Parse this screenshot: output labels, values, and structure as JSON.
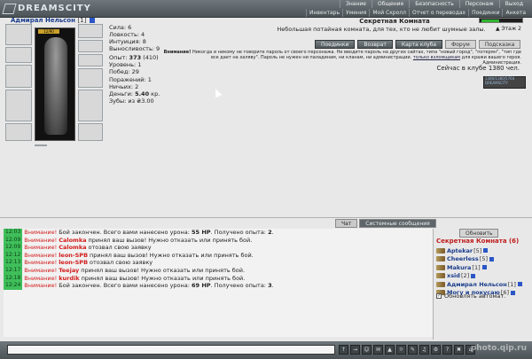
{
  "app": {
    "logo": "DREAMSCITY"
  },
  "top_menu": [
    "Знание",
    "Общение",
    "Безопасность",
    "Персонаж",
    "Выход"
  ],
  "sub_menu": [
    "Инвентарь",
    "Умения",
    "Мой Скролл",
    "Отчет о переводах",
    "Поединки",
    "Анкета"
  ],
  "character": {
    "name": "Адмирал Нельсон",
    "level": "[1]",
    "hp_label": "12/90",
    "stats": [
      "Сила: 6",
      "Ловкость: 4",
      "Интуиция: 8",
      "Выносливость: 9"
    ],
    "progress": [
      {
        "label": "Опыт: ",
        "value": "373",
        "extra": " (410)"
      },
      {
        "label": "Уровень: ",
        "value": "1",
        "extra": ""
      },
      {
        "label": "Побед: ",
        "value": "29",
        "extra": ""
      },
      {
        "label": "Поражений: ",
        "value": "1",
        "extra": ""
      },
      {
        "label": "Ничьих: ",
        "value": "2",
        "extra": ""
      },
      {
        "label": "Деньги: ",
        "value": "5.40",
        "extra": " кр."
      },
      {
        "label": "Зубы: ",
        "value": "из",
        "extra": " ₴3.00"
      }
    ]
  },
  "room": {
    "title": "Секретная Комната",
    "subtitle": "Небольшая потайная комната, для тех, кто не любит шумные залы.",
    "floor": "Этаж 2",
    "actions": [
      "Поединки",
      "Возврат",
      "Карта клуба",
      "Форум",
      "Подсказка"
    ],
    "notice_label": "Внимание!",
    "notice_text": " Никогда и никому не говорите пароль от своего персонажа. Не вводите пароль на других сайтах, типа \"новый город\", \"потерян\", \"тип где все дает на халяву\". Пароль не нужен ни паладинам, ни кланам, ни администрации.",
    "notice_link": "только взломщикам",
    "notice_tail": " для кражи вашего героя.",
    "notice_sign": "Администрация.",
    "online": "Сейчас в клубе 1380 чел.",
    "counter": [
      "1380/1380/5764",
      "DREAMSCITY"
    ]
  },
  "chat": {
    "tabs": {
      "chat": "Чат",
      "system": "Системные сообщения"
    },
    "messages": [
      {
        "time": "12:03",
        "warn": "Внимание!",
        "nick": "",
        "text": "Бой закончен. Всего вами нанесено урона: ",
        "b1": "55 HP",
        "text2": ". Получено опыта: ",
        "b2": "2",
        "text3": "."
      },
      {
        "time": "12:09",
        "warn": "Внимание!",
        "nick": "Calomka",
        "text": "принял ваш вызов! Нужно отказать или принять бой.",
        "b1": "",
        "text2": "",
        "b2": "",
        "text3": ""
      },
      {
        "time": "12:09",
        "warn": "Внимание!",
        "nick": "Calomka",
        "text": "отозвал свою заявку",
        "b1": "",
        "text2": "",
        "b2": "",
        "text3": ""
      },
      {
        "time": "12:12",
        "warn": "Внимание!",
        "nick": "leon-SPB",
        "text": "принял ваш вызов! Нужно отказать или принять бой.",
        "b1": "",
        "text2": "",
        "b2": "",
        "text3": ""
      },
      {
        "time": "12:13",
        "warn": "Внимание!",
        "nick": "leon-SPB",
        "text": "отозвал свою заявку",
        "b1": "",
        "text2": "",
        "b2": "",
        "text3": ""
      },
      {
        "time": "12:17",
        "warn": "Внимание!",
        "nick": "Teejay",
        "text": "принял ваш вызов! Нужно отказать или принять бой.",
        "b1": "",
        "text2": "",
        "b2": "",
        "text3": ""
      },
      {
        "time": "12:18",
        "warn": "Внимание!",
        "nick": "kurdik",
        "text": "принял ваш вызов! Нужно отказать или принять бой.",
        "b1": "",
        "text2": "",
        "b2": "",
        "text3": ""
      },
      {
        "time": "12:24",
        "warn": "Внимание!",
        "nick": "",
        "text": "Бой закончен. Всего вами нанесено урона: ",
        "b1": "69 HP",
        "text2": ". Получено опыта: ",
        "b2": "3",
        "text3": "."
      }
    ]
  },
  "room_panel": {
    "refresh": "Обновить",
    "title": "Секретная Комната (6)",
    "users": [
      {
        "name": "Aptekar",
        "level": "[5]"
      },
      {
        "name": "Cheerless",
        "level": "[5]"
      },
      {
        "name": "Makura",
        "level": "[1]"
      },
      {
        "name": "xsid",
        "level": "[2]"
      },
      {
        "name": "Адмирал Нельсон",
        "level": "[1]"
      },
      {
        "name": "Могу и покусаю",
        "level": "[6]"
      }
    ],
    "auto_refresh": "Обновлять автомат."
  },
  "bottom": {
    "tools": [
      "↑",
      "→",
      "☺",
      "✉",
      "▲",
      "☼",
      "✎",
      "♫",
      "⚙",
      "?",
      "✖",
      "⌂"
    ]
  },
  "watermark": "photo.qip.ru"
}
